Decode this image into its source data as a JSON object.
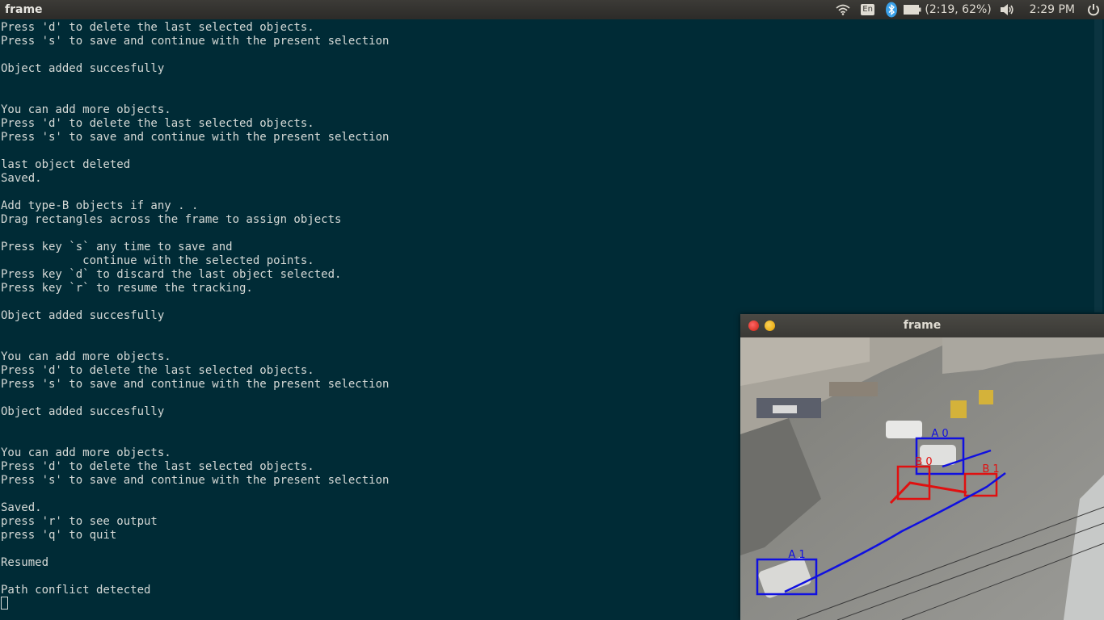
{
  "topbar": {
    "app_title": "frame",
    "keyboard_layout": "En",
    "battery_status": "(2:19, 62%)",
    "clock": "2:29 PM",
    "icons": [
      "wifi-icon",
      "keyboard-icon",
      "bluetooth-icon",
      "battery-icon",
      "volume-icon",
      "power-icon"
    ]
  },
  "terminal": {
    "lines": [
      "Press 'd' to delete the last selected objects.",
      "Press 's' to save and continue with the present selection",
      "",
      "Object added succesfully",
      "",
      "",
      "You can add more objects.",
      "Press 'd' to delete the last selected objects.",
      "Press 's' to save and continue with the present selection",
      "",
      "last object deleted",
      "Saved.",
      "",
      "Add type-B objects if any . .",
      "Drag rectangles across the frame to assign objects",
      "",
      "Press key `s` any time to save and",
      "            continue with the selected points.",
      "Press key `d` to discard the last object selected.",
      "Press key `r` to resume the tracking.",
      "",
      "Object added succesfully",
      "",
      "",
      "You can add more objects.",
      "Press 'd' to delete the last selected objects.",
      "Press 's' to save and continue with the present selection",
      "",
      "Object added succesfully",
      "",
      "",
      "You can add more objects.",
      "Press 'd' to delete the last selected objects.",
      "Press 's' to save and continue with the present selection",
      "",
      "Saved.",
      "press 'r' to see output",
      "press 'q' to quit",
      "",
      "Resumed",
      "",
      "Path conflict detected"
    ]
  },
  "frame_window": {
    "title": "frame",
    "labels": {
      "a0": "A 0",
      "a1": "A 1",
      "b0": "B 0",
      "b1": "B 1"
    },
    "colors": {
      "type_a": "#1010e0",
      "type_b": "#e01010",
      "road": "#8a8a86"
    }
  }
}
